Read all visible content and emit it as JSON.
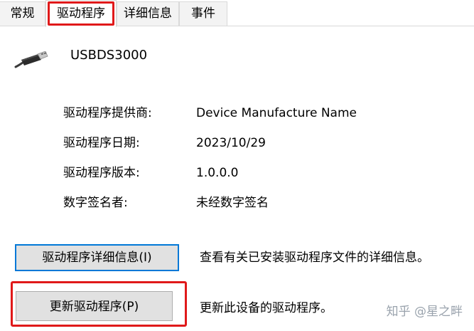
{
  "tabs": [
    {
      "label": "常规",
      "active": false
    },
    {
      "label": "驱动程序",
      "active": true
    },
    {
      "label": "详细信息",
      "active": false
    },
    {
      "label": "事件",
      "active": false
    }
  ],
  "device": {
    "icon": "usb-plug-icon",
    "name": "USBDS3000"
  },
  "properties": [
    {
      "label": "驱动程序提供商:",
      "value": "Device Manufacture Name"
    },
    {
      "label": "驱动程序日期:",
      "value": "2023/10/29"
    },
    {
      "label": "驱动程序版本:",
      "value": "1.0.0.0"
    },
    {
      "label": "数字签名者:",
      "value": "未经数字签名"
    }
  ],
  "actions": {
    "details_button": "驱动程序详细信息(I)",
    "details_desc": "查看有关已安装驱动程序文件的详细信息。",
    "update_button": "更新驱动程序(P)",
    "update_desc": "更新此设备的驱动程序。"
  },
  "watermark": "知乎 @星之畔",
  "colors": {
    "highlight": "#e0191a",
    "focus_border": "#0078d7",
    "button_bg": "#e1e1e1"
  }
}
